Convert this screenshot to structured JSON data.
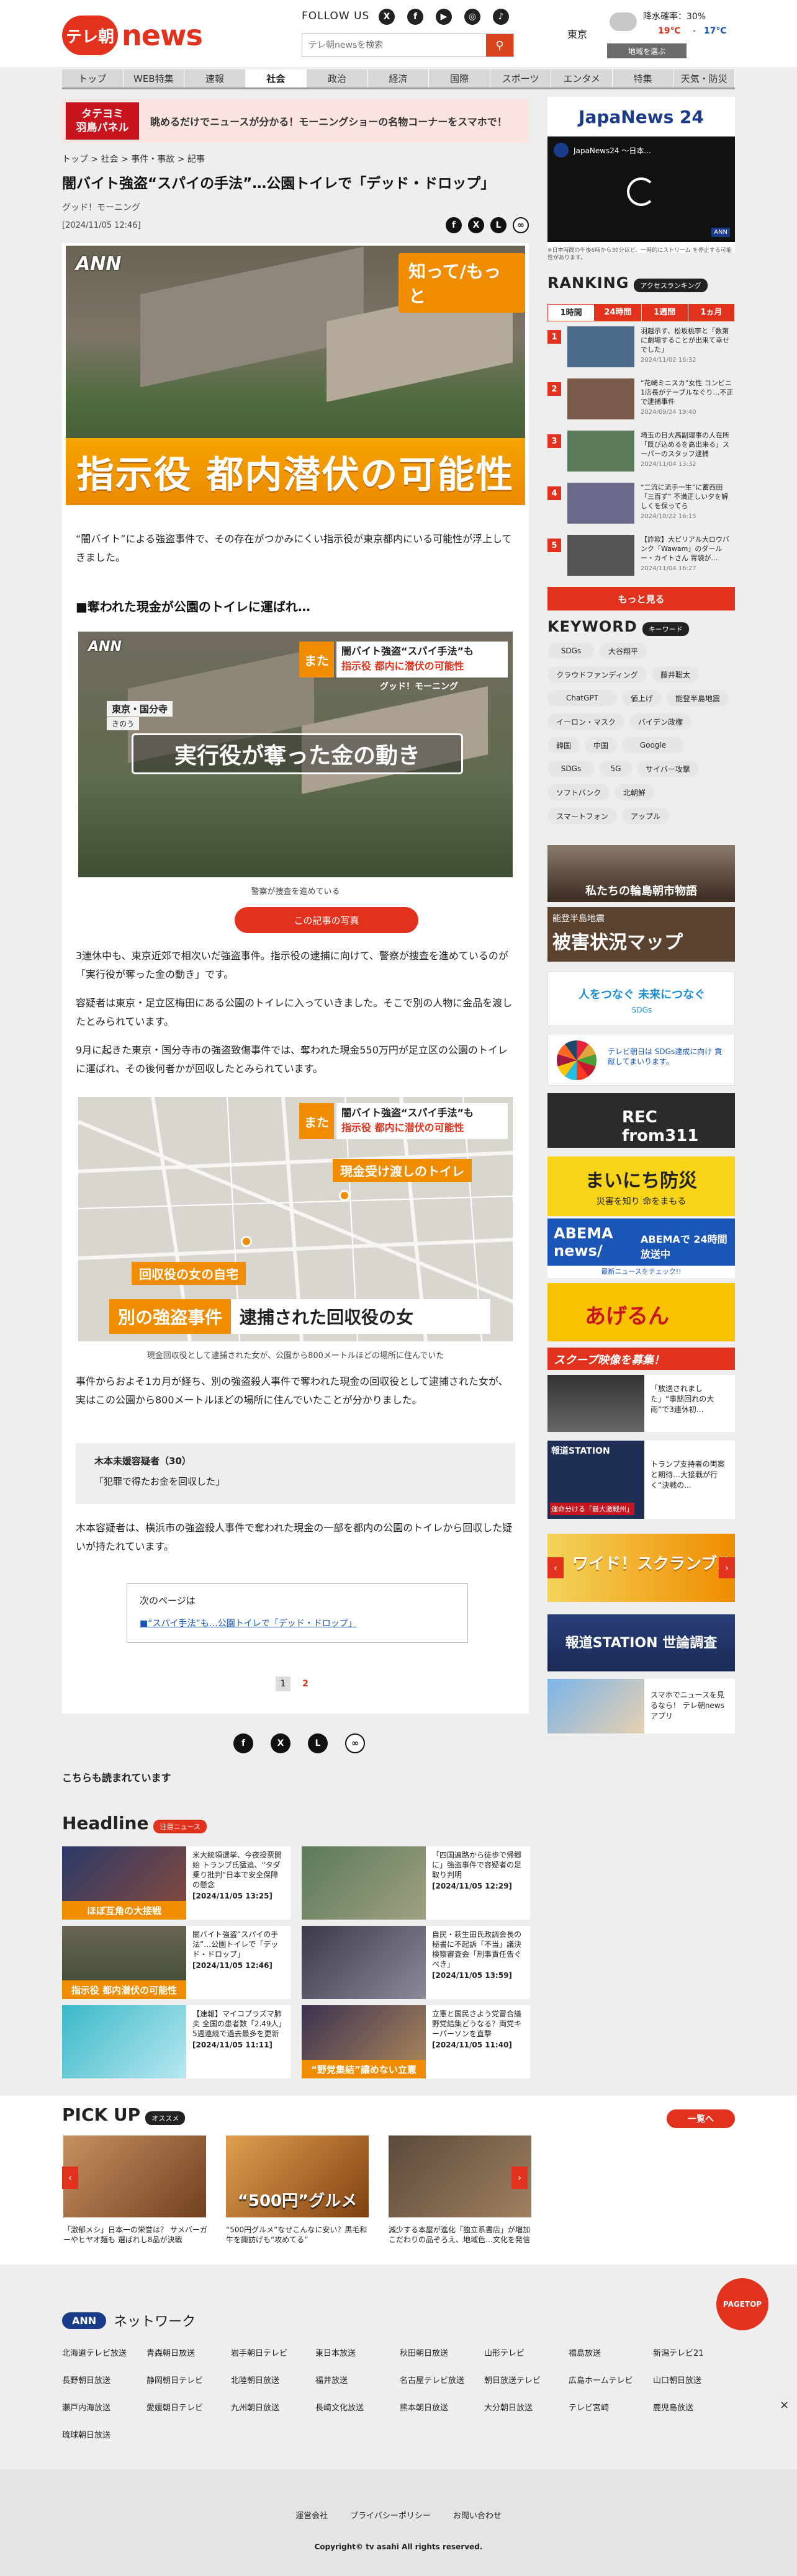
{
  "header": {
    "logo_badge": "テレ朝",
    "logo_news": "news",
    "follow_label": "FOLLOW US",
    "sns": [
      "X",
      "f",
      "▶",
      "◎",
      "♪"
    ],
    "search_placeholder": "テレ朝newsを検索",
    "weather": {
      "region": "東京",
      "precip": "降水確率：30%",
      "temp_high": "19℃",
      "temp_sep": "-",
      "temp_low": "17℃",
      "change_button": "地域を選ぶ"
    }
  },
  "nav": [
    "トップ",
    "WEB特集",
    "速報",
    "社会",
    "政治",
    "経済",
    "国際",
    "スポーツ",
    "エンタメ",
    "特集",
    "天気・防災"
  ],
  "nav_active": "社会",
  "banner": {
    "box_line1": "タテヨミ",
    "box_line2": "羽鳥パネル",
    "text": "眺めるだけでニュースが分かる！モーニングショーの名物コーナーをスマホで！"
  },
  "breadcrumb": [
    "トップ",
    "社会",
    "事件・事故",
    "記事"
  ],
  "article": {
    "title": "闇バイト強盗“スパイの手法”…公園トイレで「デッド・ドロップ」",
    "source": "グッド！モーニング",
    "date": "[2024/11/05 12:46]",
    "hero": {
      "ann": "ANN",
      "tag": "知って/もっと",
      "caption": "指示役 都内潜伏の可能性"
    },
    "lead": "“闇バイト”による強盗事件で、その存在がつかみにくい指示役が東京都内にいる可能性が浮上してきました。",
    "subhead": "■奪われた現金が公園のトイレに運ばれ…",
    "fig1": {
      "tag": "また",
      "title_line1": "闇バイト強盗“スパイ手法”も",
      "title_line2": "指示役 都内に潜伏の可能性",
      "sub": "グッド！モーニング",
      "location_line1": "東京・国分寺",
      "location_line2": "きのう",
      "caption_main": "実行役が奪った金の動き",
      "cap": "警察が捜査を進めている",
      "button": "この記事の写真"
    },
    "para1": "3連休中も、東京近郊で相次いだ強盗事件。指示役の逮捕に向けて、警察が捜査を進めているのが「実行役が奪った金の動き」です。",
    "para2": "容疑者は東京・足立区梅田にある公園のトイレに入っていきました。そこで別の人物に金品を渡したとみられています。",
    "para3": "9月に起きた東京・国分寺市の強盗致傷事件では、奪われた現金550万円が足立区の公園のトイレに運ばれ、その後何者かが回収したとみられています。",
    "fig2": {
      "tag": "また",
      "title_line1": "闇バイト強盗“スパイ手法”も",
      "title_line2": "指示役 都内に潜伏の可能性",
      "label1": "現金受け渡しのトイレ",
      "label2": "回収役の女の自宅",
      "caption_a": "別の強盗事件",
      "caption_b": "逮捕された回収役の女",
      "cap": "現金回収役として逮捕された女が、公園から800メートルほどの場所に住んでいた"
    },
    "para4": "事件からおよそ1カ月が経ち、別の強盗殺人事件で奪われた現金の回収役として逮捕された女が、実はこの公園から800メートルほどの場所に住んでいたことが分かりました。",
    "quote_name": "木本未媛容疑者（30）",
    "quote_text": "「犯罪で得たお金を回収した」",
    "para5": "木本容疑者は、横浜市の強盗殺人事件で奪われた現金の一部を都内の公園のトイレから回収した疑いが持たれています。",
    "next_label": "次のページは",
    "next_link": "■“スパイ手法”も…公園トイレで「デッド・ドロップ」",
    "pages": [
      "1",
      "2"
    ],
    "related_label": "こちらも読まれています"
  },
  "sidebar": {
    "jn24_logo": "JapaNews 24",
    "jn24_channel": "JapaNews24 ～日本...",
    "jn24_ann": "ANN",
    "jn24_note": "※日本時間の午後6時から30分ほど、一時的にストリーム を停止する可能性があります。",
    "ranking_title": "RANKING",
    "ranking_pill": "アクセスランキング",
    "ranking_tabs": [
      "1時間",
      "24時間",
      "1週間",
      "1ヵ月"
    ],
    "ranking": [
      {
        "num": "1",
        "text": "羽越示す、松坂桃李と「数第に劇場することが出来て幸せでした」",
        "time": "2024/11/02 16:32"
      },
      {
        "num": "2",
        "text": "“花崎ミニスカ”女性 コンビニ1店長がテーブルなぐり…不正で逮捕事件",
        "time": "2024/09/24 19:40"
      },
      {
        "num": "3",
        "text": "埼玉の日大高副理事の人在所「既び込めるを高出来る」スーパーのスタッフ逮捕",
        "time": "2024/11/04 13:32"
      },
      {
        "num": "4",
        "text": "“二流に流手一生”に蓄西田「三百ず” 不満正しい夕を解しくを保ってら",
        "time": "2024/10/22 16:15"
      },
      {
        "num": "5",
        "text": "【詐欺】大ピリアル大ロウバンク「Wawam」のダールー・カイトさん 胃袋が…",
        "time": "2024/11/04 16:27"
      }
    ],
    "ranking_more": "もっと見る",
    "keyword_title": "KEYWORD",
    "keyword_pill": "キーワード",
    "keywords": [
      "SDGs",
      "大谷翔平",
      "クラウドファンディング",
      "藤井聡太",
      "ChatGPT",
      "値上げ",
      "能登半島地震",
      "イーロン・マスク",
      "バイデン政権",
      "韓国",
      "中国",
      "Google",
      "SDGs",
      "5G",
      "サイバー攻撃",
      "ソフトバンク",
      "北朝鮮",
      "スマートフォン",
      "アップル"
    ],
    "banners": {
      "noto": "私たちの輪島朝市物語",
      "map_top": "能登半島地震",
      "map_main": "被害状況マップ",
      "future": "人をつなぐ 未来につなぐ",
      "future_sub": "SDGs",
      "sdgs": "テレビ朝日は SDGs達成に向け 貢献してまいります。",
      "rec": "REC from311",
      "bousai": "まいにち防災",
      "bousai_sub": "災害を知り 命をまもる",
      "abema": "ABEMA news/",
      "abema_sub": "ABEMAで 24時間放送中",
      "abema_bottom": "最新ニュースをチェック!!",
      "agerun": "あげるん",
      "scoop": "スクープ映像を募集！",
      "scoop_text": "「放送されまし た」“事態回れの大 雨”で3連休初...",
      "houdou_title": "報道STATION",
      "houdou_text": "トランプ支持者の両案と期待…大接戦が行く“決戦の...",
      "houdou_cap": "運命分ける「最大激戦州」",
      "scramble": "ワイド！スクランブル",
      "poll": "報道STATION 世論調査",
      "app": "スマホでニュースを見るなら！ テレ朝newsアプリ"
    }
  },
  "headline": {
    "title": "Headline",
    "pill": "注目ニュース",
    "items": [
      {
        "text": "米大統領選挙、今夜投票開始 トランプ氏猛追、“タダ乗り批判”日本で安全保障の懸念",
        "time": "[2024/11/05 13:25]",
        "img": "ほぼ互角の大接戦"
      },
      {
        "text": "「四国遍路から徒歩で帰郷に」強盗事件で容疑者の足取り判明",
        "time": "[2024/11/05 12:29]",
        "img": ""
      },
      {
        "text": "闇バイト強盗“スパイの手法”…公園トイレで「デッド・ドロップ」",
        "time": "[2024/11/05 12:46]",
        "img": "指示役 都内潜伏の可能性"
      },
      {
        "text": "自民・萩生田氏政調会長の秘書に不起訴「不当」議決 検察審査会「刑事責任告ぐべき」",
        "time": "[2024/11/05 13:59]",
        "img": ""
      },
      {
        "text": "【速報】マイコプラズマ肺炎 全国の患者数「2.49人」5週連続で過去最多を更新",
        "time": "[2024/11/05 11:11]",
        "img": ""
      },
      {
        "text": "立憲と国民さよう党冒合議 野党結集どうなる？両党キーパーソンを直撃",
        "time": "[2024/11/05 11:40]",
        "img": "“野党集結”讓めない立憲"
      }
    ]
  },
  "pickup": {
    "title": "PICK UP",
    "pill": "オススメ",
    "more": "一覧へ",
    "items": [
      {
        "text": "「激郁メシ」日本一の栄誉は？ サメバーガーやヒヤオ麺も 選ばれし8品が決戦",
        "img": ""
      },
      {
        "text": "“500円グルメ”なぜこんなに安い？黒毛和牛を諏訪げも“攻めてる”",
        "img": "“500円”グルメ"
      },
      {
        "text": "減少する本屋が進化「独立系書店」が増加 こだわりの品ぞろえ、地域色…文化を発信",
        "img": ""
      }
    ],
    "pagetop": "PAGETOP"
  },
  "network": {
    "logo": "ANN",
    "title": "ネットワーク",
    "stations": [
      "北海道テレビ放送",
      "青森朝日放送",
      "岩手朝日テレビ",
      "東日本放送",
      "秋田朝日放送",
      "山形テレビ",
      "福島放送",
      "新潟テレビ21",
      "長野朝日放送",
      "静岡朝日テレビ",
      "北陸朝日放送",
      "福井放送",
      "名古屋テレビ放送",
      "朝日放送テレビ",
      "広島ホームテレビ",
      "山口朝日放送",
      "瀬戸内海放送",
      "愛媛朝日テレビ",
      "九州朝日放送",
      "長崎文化放送",
      "熊本朝日放送",
      "大分朝日放送",
      "テレビ宮崎",
      "鹿児島放送",
      "琉球朝日放送"
    ],
    "close": "×"
  },
  "footer": {
    "links": [
      "運営会社",
      "プライバシーポリシー",
      "お問い合わせ"
    ],
    "copyright": "Copyright© tv asahi All rights reserved."
  }
}
